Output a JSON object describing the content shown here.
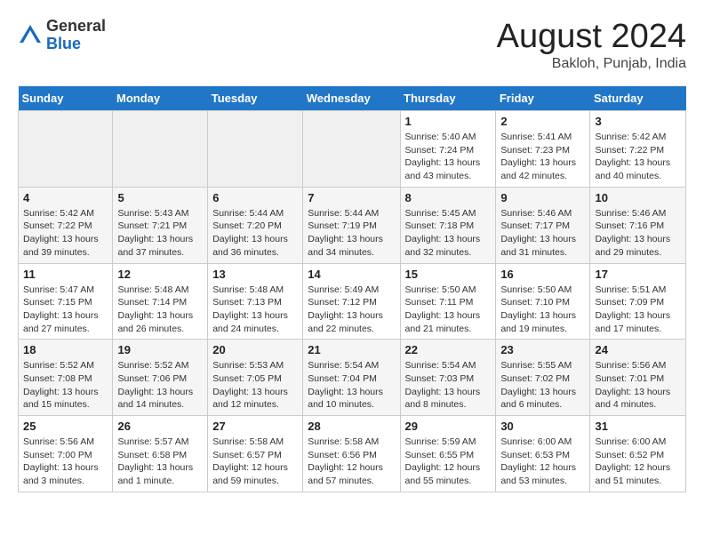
{
  "header": {
    "logo_general": "General",
    "logo_blue": "Blue",
    "month_title": "August 2024",
    "location": "Bakloh, Punjab, India"
  },
  "days_of_week": [
    "Sunday",
    "Monday",
    "Tuesday",
    "Wednesday",
    "Thursday",
    "Friday",
    "Saturday"
  ],
  "weeks": [
    [
      {
        "day": "",
        "info": ""
      },
      {
        "day": "",
        "info": ""
      },
      {
        "day": "",
        "info": ""
      },
      {
        "day": "",
        "info": ""
      },
      {
        "day": "1",
        "info": "Sunrise: 5:40 AM\nSunset: 7:24 PM\nDaylight: 13 hours\nand 43 minutes."
      },
      {
        "day": "2",
        "info": "Sunrise: 5:41 AM\nSunset: 7:23 PM\nDaylight: 13 hours\nand 42 minutes."
      },
      {
        "day": "3",
        "info": "Sunrise: 5:42 AM\nSunset: 7:22 PM\nDaylight: 13 hours\nand 40 minutes."
      }
    ],
    [
      {
        "day": "4",
        "info": "Sunrise: 5:42 AM\nSunset: 7:22 PM\nDaylight: 13 hours\nand 39 minutes."
      },
      {
        "day": "5",
        "info": "Sunrise: 5:43 AM\nSunset: 7:21 PM\nDaylight: 13 hours\nand 37 minutes."
      },
      {
        "day": "6",
        "info": "Sunrise: 5:44 AM\nSunset: 7:20 PM\nDaylight: 13 hours\nand 36 minutes."
      },
      {
        "day": "7",
        "info": "Sunrise: 5:44 AM\nSunset: 7:19 PM\nDaylight: 13 hours\nand 34 minutes."
      },
      {
        "day": "8",
        "info": "Sunrise: 5:45 AM\nSunset: 7:18 PM\nDaylight: 13 hours\nand 32 minutes."
      },
      {
        "day": "9",
        "info": "Sunrise: 5:46 AM\nSunset: 7:17 PM\nDaylight: 13 hours\nand 31 minutes."
      },
      {
        "day": "10",
        "info": "Sunrise: 5:46 AM\nSunset: 7:16 PM\nDaylight: 13 hours\nand 29 minutes."
      }
    ],
    [
      {
        "day": "11",
        "info": "Sunrise: 5:47 AM\nSunset: 7:15 PM\nDaylight: 13 hours\nand 27 minutes."
      },
      {
        "day": "12",
        "info": "Sunrise: 5:48 AM\nSunset: 7:14 PM\nDaylight: 13 hours\nand 26 minutes."
      },
      {
        "day": "13",
        "info": "Sunrise: 5:48 AM\nSunset: 7:13 PM\nDaylight: 13 hours\nand 24 minutes."
      },
      {
        "day": "14",
        "info": "Sunrise: 5:49 AM\nSunset: 7:12 PM\nDaylight: 13 hours\nand 22 minutes."
      },
      {
        "day": "15",
        "info": "Sunrise: 5:50 AM\nSunset: 7:11 PM\nDaylight: 13 hours\nand 21 minutes."
      },
      {
        "day": "16",
        "info": "Sunrise: 5:50 AM\nSunset: 7:10 PM\nDaylight: 13 hours\nand 19 minutes."
      },
      {
        "day": "17",
        "info": "Sunrise: 5:51 AM\nSunset: 7:09 PM\nDaylight: 13 hours\nand 17 minutes."
      }
    ],
    [
      {
        "day": "18",
        "info": "Sunrise: 5:52 AM\nSunset: 7:08 PM\nDaylight: 13 hours\nand 15 minutes."
      },
      {
        "day": "19",
        "info": "Sunrise: 5:52 AM\nSunset: 7:06 PM\nDaylight: 13 hours\nand 14 minutes."
      },
      {
        "day": "20",
        "info": "Sunrise: 5:53 AM\nSunset: 7:05 PM\nDaylight: 13 hours\nand 12 minutes."
      },
      {
        "day": "21",
        "info": "Sunrise: 5:54 AM\nSunset: 7:04 PM\nDaylight: 13 hours\nand 10 minutes."
      },
      {
        "day": "22",
        "info": "Sunrise: 5:54 AM\nSunset: 7:03 PM\nDaylight: 13 hours\nand 8 minutes."
      },
      {
        "day": "23",
        "info": "Sunrise: 5:55 AM\nSunset: 7:02 PM\nDaylight: 13 hours\nand 6 minutes."
      },
      {
        "day": "24",
        "info": "Sunrise: 5:56 AM\nSunset: 7:01 PM\nDaylight: 13 hours\nand 4 minutes."
      }
    ],
    [
      {
        "day": "25",
        "info": "Sunrise: 5:56 AM\nSunset: 7:00 PM\nDaylight: 13 hours\nand 3 minutes."
      },
      {
        "day": "26",
        "info": "Sunrise: 5:57 AM\nSunset: 6:58 PM\nDaylight: 13 hours\nand 1 minute."
      },
      {
        "day": "27",
        "info": "Sunrise: 5:58 AM\nSunset: 6:57 PM\nDaylight: 12 hours\nand 59 minutes."
      },
      {
        "day": "28",
        "info": "Sunrise: 5:58 AM\nSunset: 6:56 PM\nDaylight: 12 hours\nand 57 minutes."
      },
      {
        "day": "29",
        "info": "Sunrise: 5:59 AM\nSunset: 6:55 PM\nDaylight: 12 hours\nand 55 minutes."
      },
      {
        "day": "30",
        "info": "Sunrise: 6:00 AM\nSunset: 6:53 PM\nDaylight: 12 hours\nand 53 minutes."
      },
      {
        "day": "31",
        "info": "Sunrise: 6:00 AM\nSunset: 6:52 PM\nDaylight: 12 hours\nand 51 minutes."
      }
    ]
  ]
}
